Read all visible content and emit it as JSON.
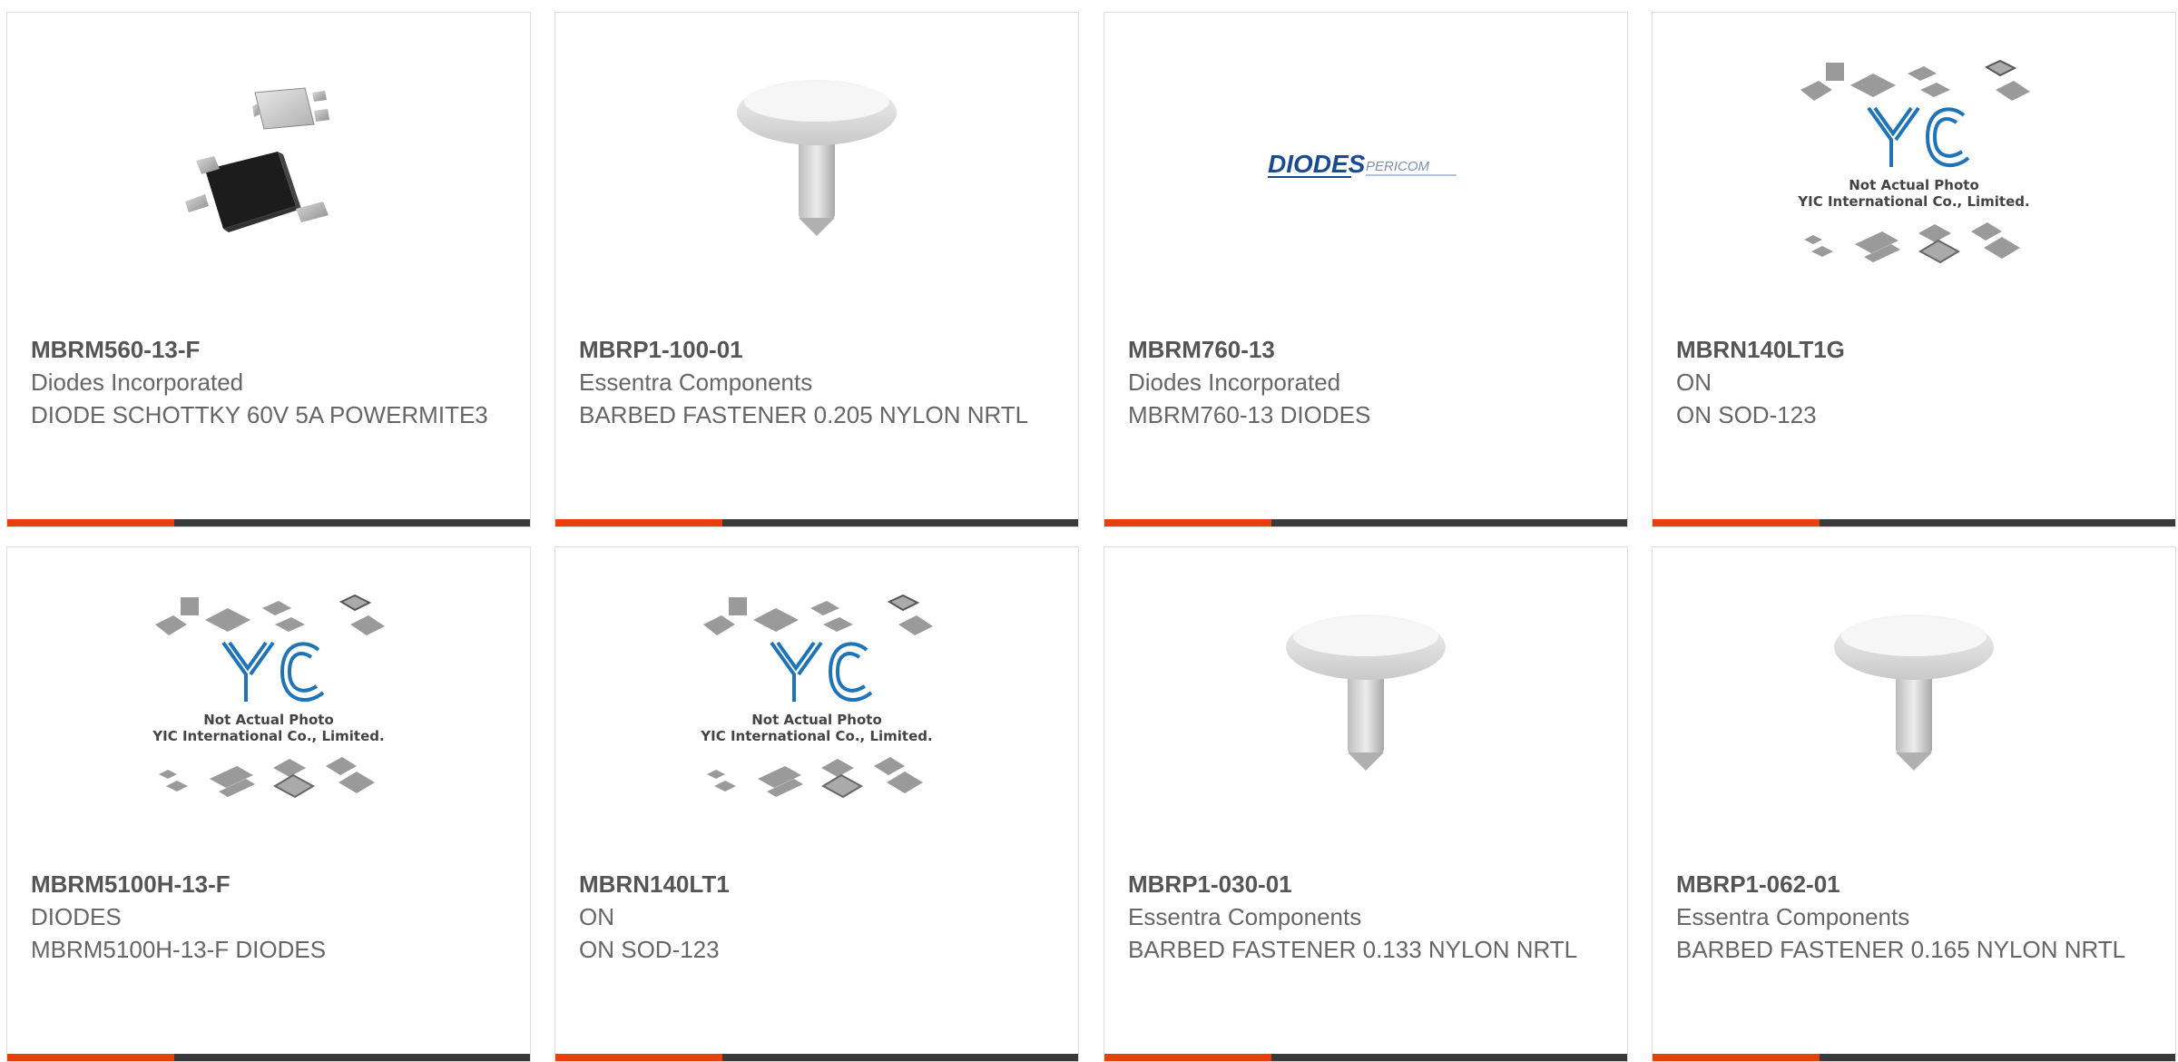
{
  "colors": {
    "accent": "#e8400c",
    "bar": "#3a3a3a",
    "border": "#dddddd"
  },
  "products": [
    {
      "part": "MBRM560-13-F",
      "manufacturer": "Diodes Incorporated",
      "description": "DIODE SCHOTTKY 60V 5A POWERMITE3",
      "image": "powermite-package-icon"
    },
    {
      "part": "MBRP1-100-01",
      "manufacturer": "Essentra Components",
      "description": "BARBED FASTENER 0.205 NYLON NRTL",
      "image": "barbed-fastener-icon"
    },
    {
      "part": "MBRM760-13",
      "manufacturer": "Diodes Incorporated",
      "description": "MBRM760-13 DIODES",
      "image": "diodes-pericom-logo",
      "logo_text": [
        "DIODES",
        "PERICOM"
      ]
    },
    {
      "part": "MBRN140LT1G",
      "manufacturer": "ON",
      "description": "ON SOD-123",
      "image": "yic-placeholder",
      "note": [
        "Not Actual Photo",
        "YIC International Co., Limited."
      ]
    },
    {
      "part": "MBRM5100H-13-F",
      "manufacturer": "DIODES",
      "description": "MBRM5100H-13-F DIODES",
      "image": "yic-placeholder",
      "note": [
        "Not Actual Photo",
        "YIC International Co., Limited."
      ]
    },
    {
      "part": "MBRN140LT1",
      "manufacturer": "ON",
      "description": "ON SOD-123",
      "image": "yic-placeholder",
      "note": [
        "Not Actual Photo",
        "YIC International Co., Limited."
      ]
    },
    {
      "part": "MBRP1-030-01",
      "manufacturer": "Essentra Components",
      "description": "BARBED FASTENER 0.133 NYLON NRTL",
      "image": "barbed-fastener-icon"
    },
    {
      "part": "MBRP1-062-01",
      "manufacturer": "Essentra Components",
      "description": "BARBED FASTENER 0.165 NYLON NRTL",
      "image": "barbed-fastener-icon"
    }
  ]
}
